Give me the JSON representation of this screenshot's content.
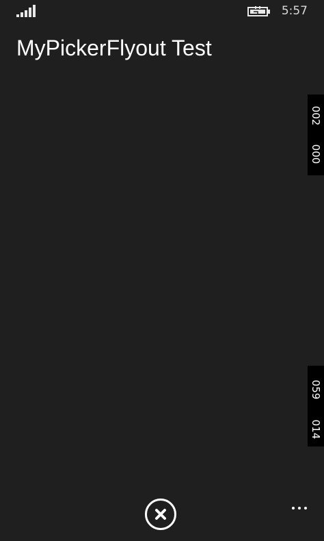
{
  "status_bar": {
    "time": "5:57",
    "signal_icon": "signal-strength-icon",
    "battery_icon": "battery-charging-icon"
  },
  "page": {
    "title": "MyPickerFlyout Test"
  },
  "pickers": {
    "top": {
      "value_a": "002",
      "value_b": "000"
    },
    "bottom": {
      "value_a": "059",
      "value_b": "014"
    }
  },
  "app_bar": {
    "primary_icon": "close-circle-icon",
    "more_icon": "ellipsis-icon"
  },
  "colors": {
    "background": "#1f1f1f",
    "foreground": "#ffffff",
    "picker_background": "#000000"
  }
}
